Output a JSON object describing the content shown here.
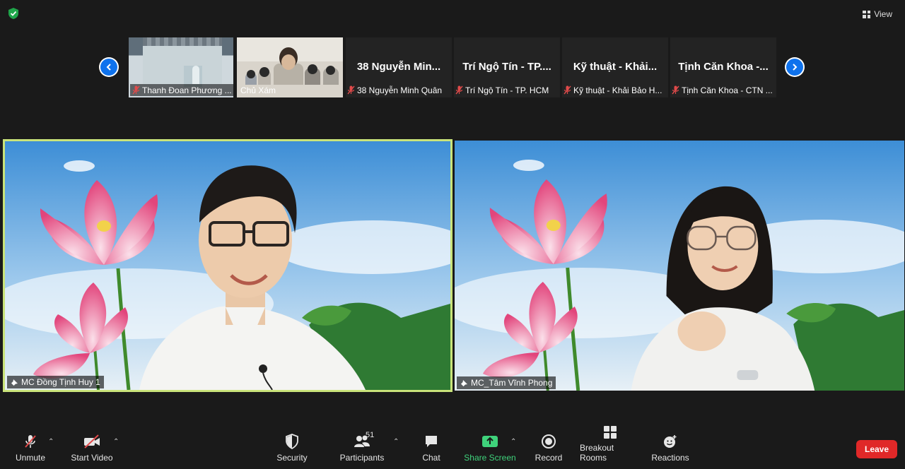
{
  "top": {
    "view_label": "View"
  },
  "strip": {
    "thumbnails": [
      {
        "type": "video",
        "name": "Thanh Đoan Phương ...",
        "muted": true
      },
      {
        "type": "video",
        "name": "Chủ Xám",
        "muted": false
      },
      {
        "type": "name",
        "big_name": "38 Nguyễn Min...",
        "name": "38 Nguyễn Minh Quân",
        "muted": true
      },
      {
        "type": "name",
        "big_name": "Trí Ngộ Tín - TP....",
        "name": "Trí Ngộ Tín - TP. HCM",
        "muted": true
      },
      {
        "type": "name",
        "big_name": "Kỹ thuật - Khải...",
        "name": "Kỹ thuật - Khải Bảo H...",
        "muted": true
      },
      {
        "type": "name",
        "big_name": "Tịnh Căn Khoa -...",
        "name": "Tịnh Căn Khoa - CTN ...",
        "muted": true
      }
    ]
  },
  "videos": {
    "left": {
      "name": "MC Đồng Tịnh Huy 1",
      "active_speaker": true
    },
    "right": {
      "name": "MC_Tâm Vĩnh Phong",
      "active_speaker": false
    }
  },
  "toolbar": {
    "unmute": "Unmute",
    "start_video": "Start Video",
    "security": "Security",
    "participants": "Participants",
    "participants_count": "51",
    "chat": "Chat",
    "share_screen": "Share Screen",
    "record": "Record",
    "breakout_rooms": "Breakout Rooms",
    "reactions": "Reactions",
    "leave": "Leave"
  },
  "colors": {
    "accent_blue": "#0e72ed",
    "active_speaker_border": "#c9e37a",
    "share_green": "#3fd27b",
    "leave_red": "#e02828"
  }
}
